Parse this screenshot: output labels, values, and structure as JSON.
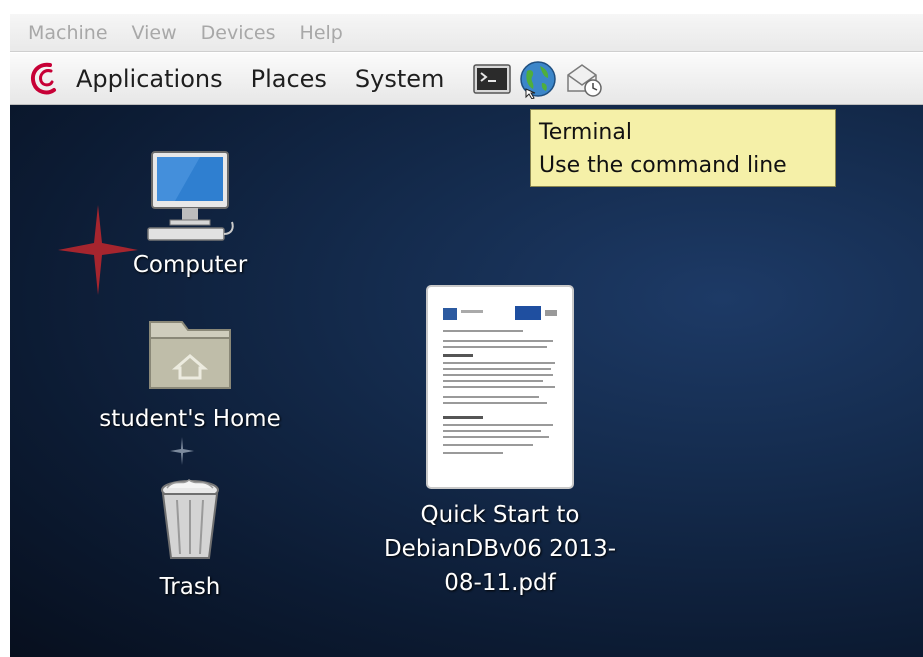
{
  "vbox_menu": {
    "items": [
      "Machine",
      "View",
      "Devices",
      "Help"
    ]
  },
  "panel": {
    "menus": [
      "Applications",
      "Places",
      "System"
    ],
    "launchers": [
      "terminal-icon",
      "web-browser-icon",
      "mail-client-icon"
    ]
  },
  "tooltip": {
    "title": "Terminal",
    "description": "Use the command line"
  },
  "desktop": {
    "icons": [
      {
        "label": "Computer"
      },
      {
        "label": "student's Home"
      },
      {
        "label": "Trash"
      },
      {
        "label": "Quick Start to DebianDBv06  2013-08-11.pdf"
      }
    ]
  },
  "colors": {
    "tooltip_bg": "#f5f0a8",
    "desktop_bg": "#0c1b33",
    "debian_red": "#c70036"
  }
}
